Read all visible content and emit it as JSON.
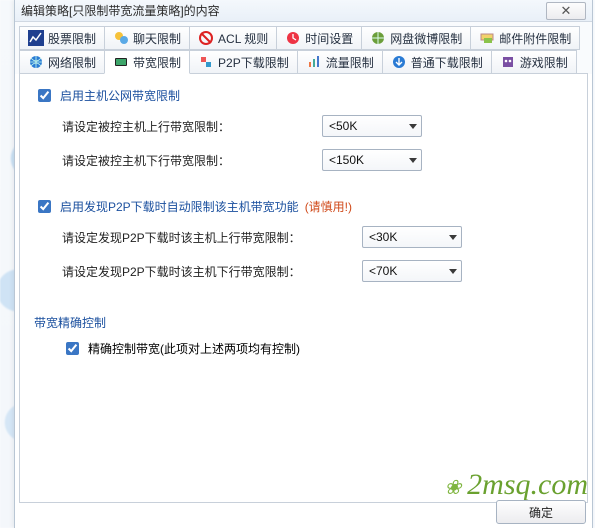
{
  "title": "编辑策略[只限制带宽流量策略]的内容",
  "tabs_row1": [
    {
      "label": "股票限制",
      "icon": "stock-icon"
    },
    {
      "label": "聊天限制",
      "icon": "chat-icon"
    },
    {
      "label": "ACL 规则",
      "icon": "acl-icon"
    },
    {
      "label": "时间设置",
      "icon": "time-icon"
    },
    {
      "label": "网盘微博限制",
      "icon": "netdisk-icon"
    },
    {
      "label": "邮件附件限制",
      "icon": "mail-icon"
    }
  ],
  "tabs_row2": [
    {
      "label": "网络限制",
      "icon": "net-icon"
    },
    {
      "label": "带宽限制",
      "icon": "bandwidth-icon",
      "active": true
    },
    {
      "label": "P2P下载限制",
      "icon": "p2p-icon"
    },
    {
      "label": "流量限制",
      "icon": "traffic-icon"
    },
    {
      "label": "普通下载限制",
      "icon": "download-icon"
    },
    {
      "label": "游戏限制",
      "icon": "game-icon"
    }
  ],
  "group1": {
    "enable_label": "启用主机公网带宽限制",
    "enable_checked": true,
    "up_label": "请设定被控主机上行带宽限制：",
    "up_value": "<50K",
    "down_label": "请设定被控主机下行带宽限制：",
    "down_value": "<150K"
  },
  "group2": {
    "enable_label": "启用发现P2P下载时自动限制该主机带宽功能",
    "enable_warn": "(请慎用!)",
    "enable_checked": true,
    "up_label": "请设定发现P2P下载时该主机上行带宽限制：",
    "up_value": "<30K",
    "down_label": "请设定发现P2P下载时该主机下行带宽限制：",
    "down_value": "<70K"
  },
  "group3": {
    "title": "带宽精确控制",
    "precise_label": "精确控制带宽(此项对上述两项均有控制)",
    "precise_checked": true
  },
  "ok_label": "确定",
  "watermark": "2msq.com"
}
